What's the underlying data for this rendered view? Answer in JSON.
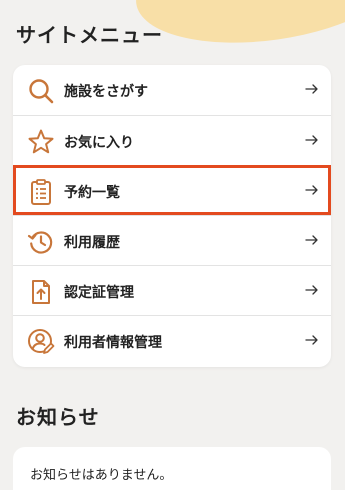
{
  "header": {
    "title": "サイトメニュー"
  },
  "menu": {
    "items": [
      {
        "label": "施設をさがす",
        "icon": "search-icon"
      },
      {
        "label": "お気に入り",
        "icon": "star-icon"
      },
      {
        "label": "予約一覧",
        "icon": "clipboard-icon",
        "selected": true
      },
      {
        "label": "利用履歴",
        "icon": "history-icon"
      },
      {
        "label": "認定証管理",
        "icon": "certificate-upload-icon"
      },
      {
        "label": "利用者情報管理",
        "icon": "user-edit-icon"
      }
    ]
  },
  "news": {
    "title": "お知らせ",
    "empty_message": "お知らせはありません。"
  },
  "colors": {
    "accent": "#c8763a",
    "highlight": "#e34a1f",
    "blob": "#f8dfa7",
    "background": "#f2f1ef"
  }
}
